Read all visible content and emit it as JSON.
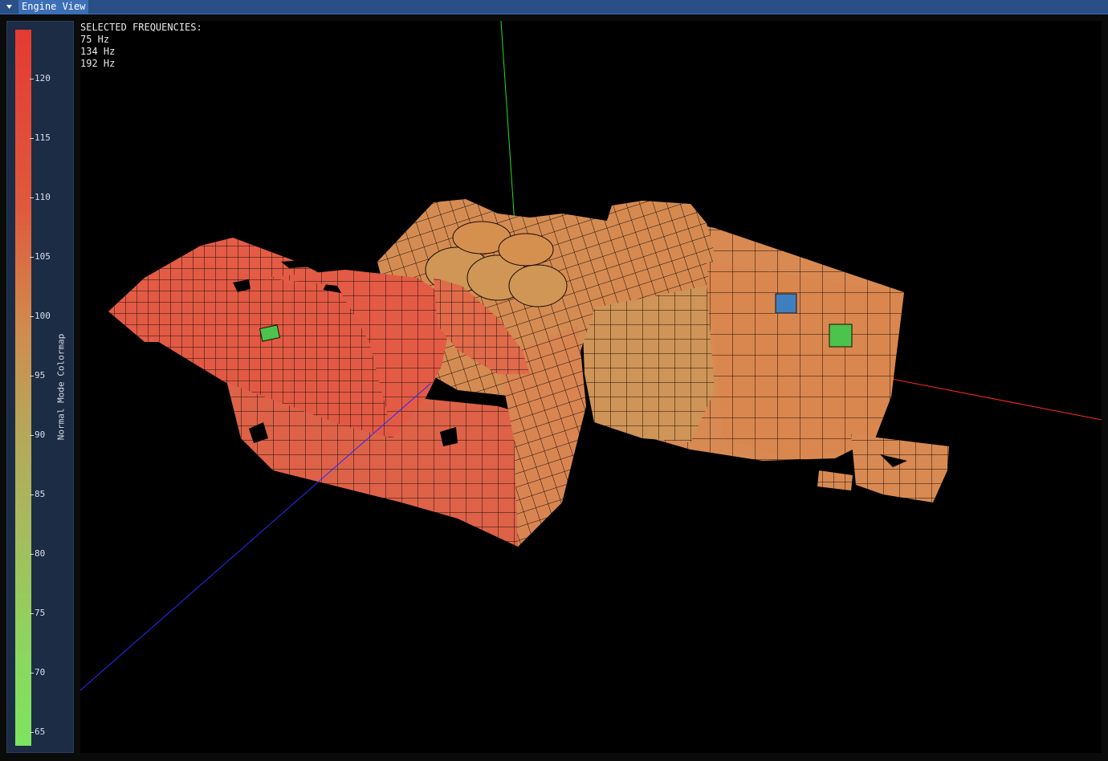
{
  "window": {
    "title": "Engine View"
  },
  "colorbar": {
    "title": "Normal Mode Colormap",
    "ticks": [
      "120",
      "115",
      "110",
      "105",
      "100",
      "95",
      "90",
      "85",
      "80",
      "75",
      "70",
      "65"
    ],
    "colors": {
      "top": "#e43a33",
      "mid": "#cf8c4e",
      "bottom": "#7de45f"
    }
  },
  "overlay": {
    "heading": "SELECTED FREQUENCIES:",
    "frequencies": [
      "75 Hz",
      "134 Hz",
      "192 Hz"
    ]
  },
  "viewport": {
    "axis_colors": {
      "x": "#ff2a2a",
      "y": "#22dd22",
      "z": "#2a2aff"
    },
    "highlight_colors": {
      "blue": "#3f7fbf",
      "green": "#4cc34c"
    },
    "mesh_colors": {
      "red": "#e05a44",
      "orange": "#d88a52",
      "tan": "#cf9a58",
      "outline": "#1a0d06"
    }
  }
}
